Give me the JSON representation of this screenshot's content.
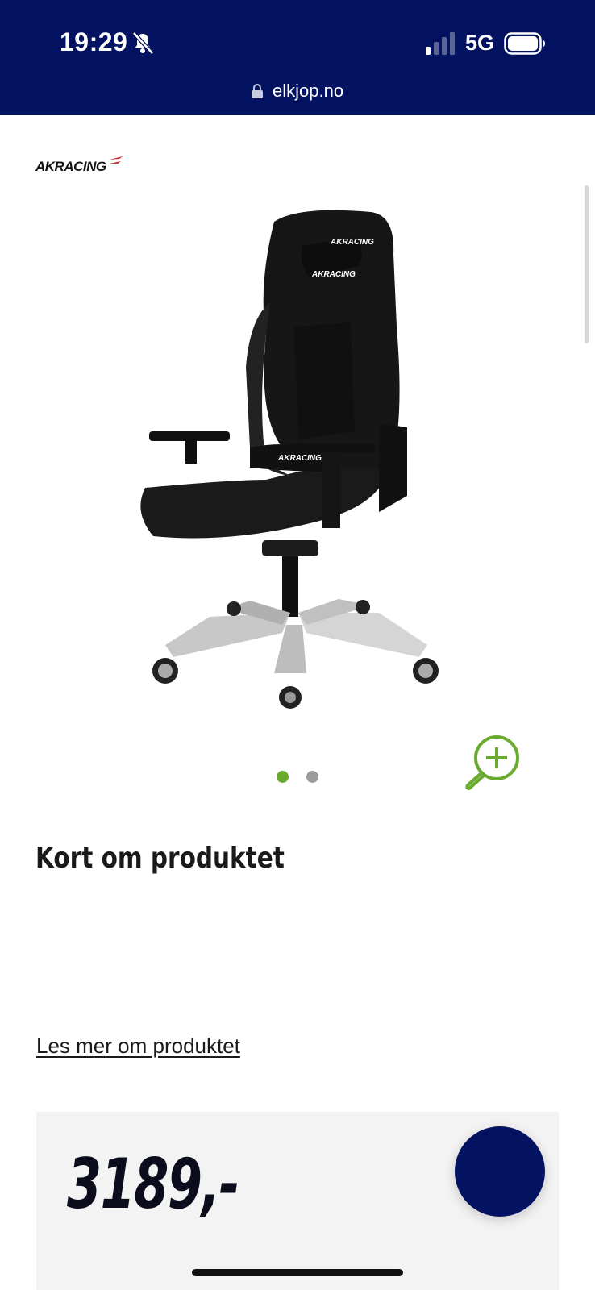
{
  "status_bar": {
    "time": "19:29",
    "network": "5G",
    "url": "elkjop.no"
  },
  "brand": {
    "name": "AKRACING"
  },
  "gallery": {
    "image_icon": "gaming-chair-image",
    "pager_dots_count": 2,
    "active_dot": 1,
    "zoom_icon": "zoom-in-icon"
  },
  "product": {
    "section_heading": "Kort om produktet",
    "read_more_link": "Les mer om produktet",
    "price": "3189,-"
  },
  "colors": {
    "header_bg": "#041361",
    "accent_green": "#6aaa2e",
    "price_box_bg": "#f3f3f3",
    "chat_button": "#041361"
  }
}
